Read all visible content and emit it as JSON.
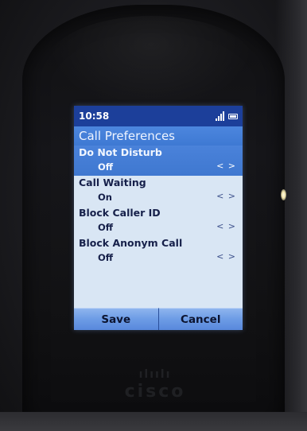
{
  "status_bar": {
    "time": "10:58"
  },
  "header": {
    "title": "Call Preferences"
  },
  "preferences": [
    {
      "label": "Do Not Disturb",
      "value": "Off",
      "arrows": "< >",
      "selected": true
    },
    {
      "label": "Call Waiting",
      "value": "On",
      "arrows": "< >",
      "selected": false
    },
    {
      "label": "Block Caller ID",
      "value": "Off",
      "arrows": "< >",
      "selected": false
    },
    {
      "label": "Block Anonym Call",
      "value": "Off",
      "arrows": "< >",
      "selected": false
    }
  ],
  "softkeys": {
    "save_label": "Save",
    "cancel_label": "Cancel"
  },
  "device": {
    "brand": "cisco"
  },
  "colors": {
    "status_bar": "#1c3f9a",
    "selection": "#4a82da",
    "list_background": "#d9e6f4",
    "softkey": "#6f9ee6"
  },
  "icons": [
    "signal-strength-icon",
    "battery-icon"
  ]
}
